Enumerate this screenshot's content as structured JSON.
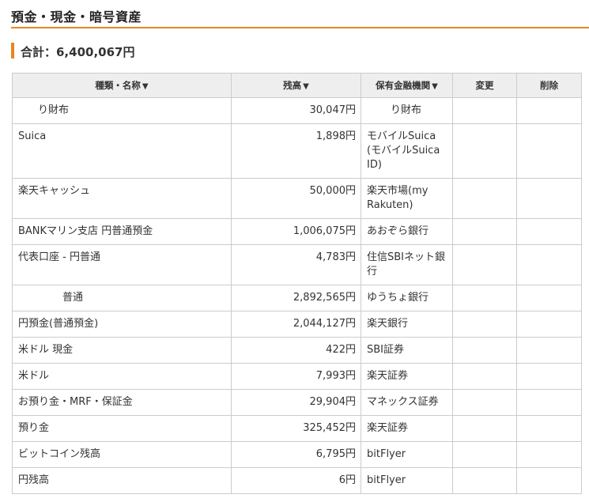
{
  "section": {
    "title": "預金・現金・暗号資産"
  },
  "total": {
    "label": "合計：6,400,067円"
  },
  "table": {
    "headers": {
      "name": "種類・名称",
      "balance": "残高",
      "institution": "保有金融機関",
      "change": "変更",
      "delete": "削除"
    },
    "rows": [
      {
        "name": "り財布",
        "balance": "30,047円",
        "institution": "り財布"
      },
      {
        "name": "Suica",
        "balance": "1,898円",
        "institution": "モバイルSuica (モバイルSuica ID)"
      },
      {
        "name": "楽天キャッシュ",
        "balance": "50,000円",
        "institution": "楽天市場(my Rakuten)"
      },
      {
        "name": "BANKマリン支店 円普通預金",
        "balance": "1,006,075円",
        "institution": "あおぞら銀行"
      },
      {
        "name": "代表口座 - 円普通",
        "balance": "4,783円",
        "institution": "住信SBIネット銀行"
      },
      {
        "name": "普通",
        "balance": "2,892,565円",
        "institution": "ゆうちょ銀行"
      },
      {
        "name": "円預金(普通預金)",
        "balance": "2,044,127円",
        "institution": "楽天銀行"
      },
      {
        "name": "米ドル 現金",
        "balance": "422円",
        "institution": "SBI証券"
      },
      {
        "name": "米ドル",
        "balance": "7,993円",
        "institution": "楽天証券"
      },
      {
        "name": "お預り金・MRF・保証金",
        "balance": "29,904円",
        "institution": "マネックス証券"
      },
      {
        "name": "預り金",
        "balance": "325,452円",
        "institution": "楽天証券"
      },
      {
        "name": "ビットコイン残高",
        "balance": "6,795円",
        "institution": "bitFlyer"
      },
      {
        "name": "円残高",
        "balance": "6円",
        "institution": "bitFlyer"
      }
    ]
  },
  "icons": {
    "sort": "sort-down-triangle-icon"
  },
  "colors": {
    "accent": "#e8861a",
    "header_bg": "#eeeeee",
    "border": "#cccccc"
  }
}
